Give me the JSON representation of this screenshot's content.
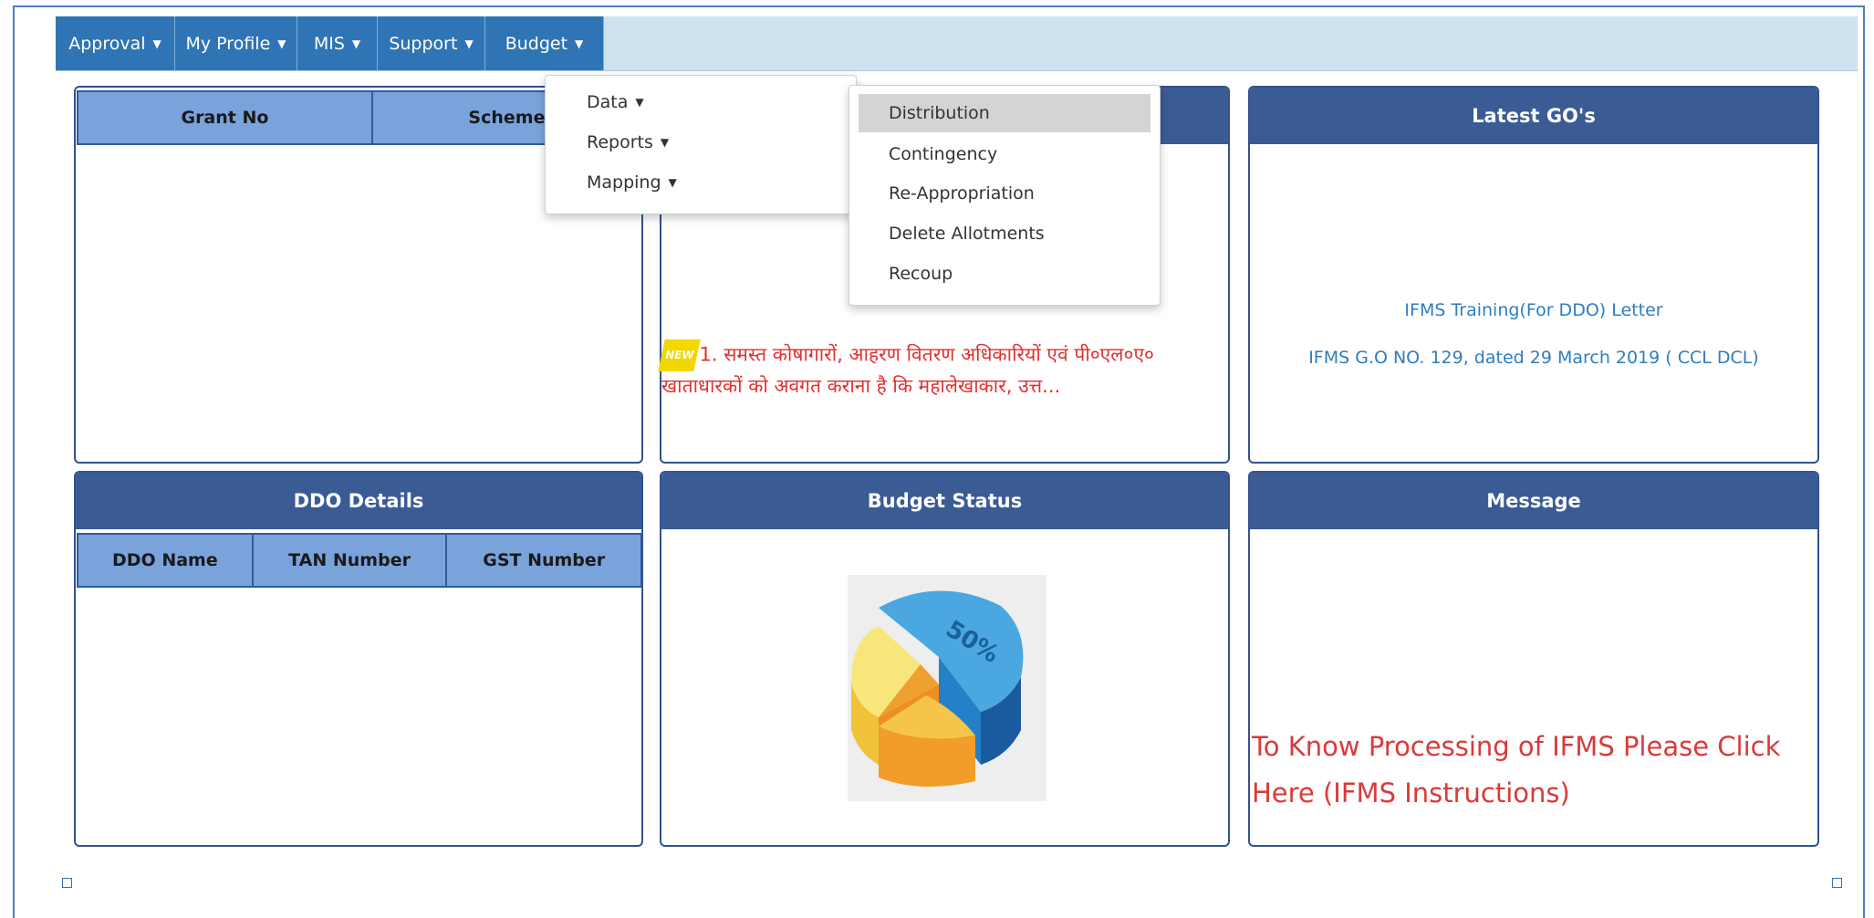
{
  "nav": {
    "items": [
      {
        "label": "Approval"
      },
      {
        "label": "My Profile"
      },
      {
        "label": "MIS"
      },
      {
        "label": "Support"
      },
      {
        "label": "Budget"
      }
    ]
  },
  "budget_menu": {
    "items": [
      {
        "label": "Data"
      },
      {
        "label": "Reports"
      },
      {
        "label": "Mapping"
      }
    ]
  },
  "data_submenu": {
    "items": [
      {
        "label": "Distribution",
        "highlighted": true
      },
      {
        "label": "Contingency"
      },
      {
        "label": "Re-Appropriation"
      },
      {
        "label": "Delete Allotments"
      },
      {
        "label": "Recoup"
      }
    ]
  },
  "grant_panel": {
    "columns": [
      "Grant No",
      "Scheme"
    ]
  },
  "news_panel": {
    "badge": "NEW",
    "text": "1. समस्त कोषागारों, आहरण वितरण अधिकारियों एवं पी०एल०ए० खाताधारकों को अवगत कराना है कि महालेखाकार, उत्त..."
  },
  "latest_go": {
    "title": "Latest GO's",
    "links": [
      "IFMS Training(For DDO) Letter",
      "IFMS G.O NO. 129, dated 29 March 2019 ( CCL DCL)"
    ]
  },
  "ddo_details": {
    "title": "DDO Details",
    "columns": [
      "DDO Name",
      "TAN Number",
      "GST Number"
    ]
  },
  "budget_status": {
    "title": "Budget Status",
    "chart_label": "50%"
  },
  "message": {
    "title": "Message",
    "line1": "To Know Processing of IFMS Please Click",
    "line2": "Here (IFMS Instructions)"
  },
  "colors": {
    "nav": "#2f74b5",
    "panel_header": "#3b5b94",
    "table_header": "#7aa3dc",
    "link": "#2f7dbf",
    "alert_text": "#e03030"
  }
}
